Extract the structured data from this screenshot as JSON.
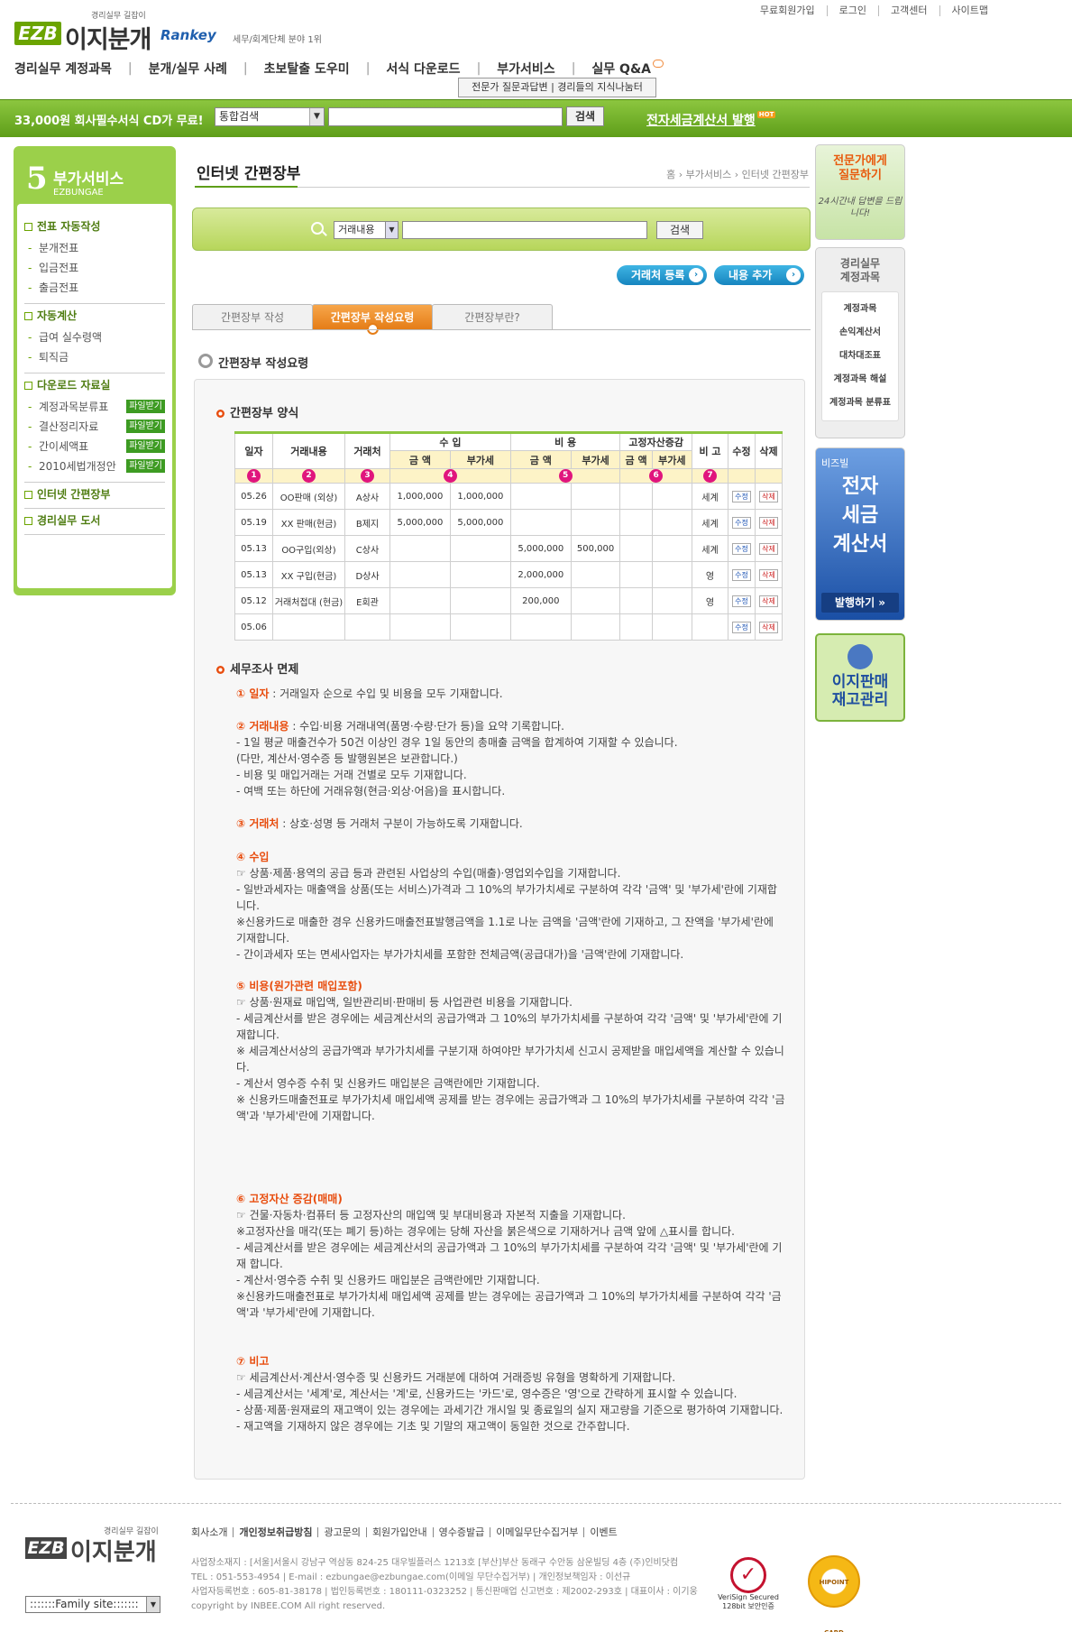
{
  "top_links": [
    "무료회원가입",
    "로그인",
    "고객센터",
    "사이트맵"
  ],
  "logo": {
    "tagline": "경리실무 길잡이",
    "mark": "EZB",
    "name": "이지분개",
    "partner": "Rankey",
    "partner_note": "세무/회계단체 분야 1위"
  },
  "gnb": [
    "경리실무 계정과목",
    "분개/실무 사례",
    "초보탈출 도우미",
    "서식 다운로드",
    "부가서비스",
    "실무 Q&A"
  ],
  "gnb_popup": "전문가 질문과답변 | 경리들의 지식나눔터",
  "greenbar": {
    "promo": "33,000원 회사필수서식 CD가 무료!",
    "select_value": "통합검색",
    "search_button": "검색",
    "etax_link": "전자세금계산서 발행",
    "hot": "HOT"
  },
  "lnb": {
    "number": "5",
    "title": "부가서비스",
    "title_en": "EZBUNGAE",
    "groups": [
      {
        "title": "전표 자동작성",
        "items": [
          {
            "label": "분개전표"
          },
          {
            "label": "입금전표"
          },
          {
            "label": "출금전표"
          }
        ]
      },
      {
        "title": "자동계산",
        "items": [
          {
            "label": "급여 실수령액"
          },
          {
            "label": "퇴직금"
          }
        ]
      },
      {
        "title": "다운로드 자료실",
        "items": [
          {
            "label": "계정과목분류표",
            "badge": "파일받기"
          },
          {
            "label": "결산정리자료",
            "badge": "파일받기"
          },
          {
            "label": "간이세액표",
            "badge": "파일받기"
          },
          {
            "label": "2010세법개정안",
            "badge": "파일받기"
          }
        ]
      },
      {
        "title": "인터넷 간편장부",
        "items": []
      },
      {
        "title": "경리실무 도서",
        "items": []
      }
    ]
  },
  "page": {
    "title": "인터넷 간편장부",
    "breadcrumb": "홈 › 부가서비스 › 인터넷 간편장부"
  },
  "search": {
    "select_value": "거래내용",
    "button": "검색"
  },
  "actions": {
    "register_partner": "거래처 등록",
    "add_content": "내용 추가"
  },
  "tabs": [
    "간편장부 작성",
    "간편장부 작성요령",
    "간편장부란?"
  ],
  "section_title": "간편장부 작성요령",
  "table": {
    "heading": "간편장부 양식",
    "groups": {
      "income": "수 입",
      "expense": "비 용",
      "asset": "고정자산증감"
    },
    "cols": {
      "date": "일자",
      "content": "거래내용",
      "partner": "거래처",
      "amount": "금 액",
      "vat": "부가세",
      "note": "비 고",
      "edit": "수정",
      "delete": "삭제"
    },
    "bubbles": [
      "1",
      "2",
      "3",
      "4",
      "5",
      "6",
      "7"
    ],
    "rows": [
      {
        "date": "05.26",
        "content": "OO판매 (외상)",
        "partner": "A상사",
        "inc_amt": "1,000,000",
        "inc_vat": "1,000,000",
        "exp_amt": "",
        "exp_vat": "",
        "as_amt": "",
        "as_vat": "",
        "note": "세계"
      },
      {
        "date": "05.19",
        "content": "XX 판매(현금)",
        "partner": "B제지",
        "inc_amt": "5,000,000",
        "inc_vat": "5,000,000",
        "exp_amt": "",
        "exp_vat": "",
        "as_amt": "",
        "as_vat": "",
        "note": "세계"
      },
      {
        "date": "05.13",
        "content": "OO구입(외상)",
        "partner": "C상사",
        "inc_amt": "",
        "inc_vat": "",
        "exp_amt": "5,000,000",
        "exp_vat": "500,000",
        "as_amt": "",
        "as_vat": "",
        "note": "세계"
      },
      {
        "date": "05.13",
        "content": "XX 구입(현금)",
        "partner": "D상사",
        "inc_amt": "",
        "inc_vat": "",
        "exp_amt": "2,000,000",
        "exp_vat": "",
        "as_amt": "",
        "as_vat": "",
        "note": "영"
      },
      {
        "date": "05.12",
        "content": "거래처접대 (현금)",
        "partner": "E회관",
        "inc_amt": "",
        "inc_vat": "",
        "exp_amt": "200,000",
        "exp_vat": "",
        "as_amt": "",
        "as_vat": "",
        "note": "영"
      },
      {
        "date": "05.06",
        "content": "",
        "partner": "",
        "inc_amt": "",
        "inc_vat": "",
        "exp_amt": "",
        "exp_vat": "",
        "as_amt": "",
        "as_vat": "",
        "note": ""
      }
    ],
    "edit_label": "수정",
    "delete_label": "삭제"
  },
  "guide": {
    "heading": "세무조사 면제",
    "items": [
      {
        "title": "① 일자",
        "lines": [
          ": 거래일자 순으로 수입 및 비용을 모두 기재합니다."
        ]
      },
      {
        "title": "② 거래내용",
        "lines": [
          ": 수입·비용 거래내역(품명·수량·단가 등)을 요약 기록합니다.",
          "- 1일 평균 매출건수가 50건 이상인 경우 1일 동안의 총매출 금액을 합계하여 기재할 수 있습니다.",
          "(다만, 계산서·영수증 등 발행원본은 보관합니다.)",
          "- 비용 및 매입거래는 거래 건별로 모두 기재합니다.",
          "- 여백 또는 하단에 거래유형(현금·외상·어음)을 표시합니다."
        ]
      },
      {
        "title": "③ 거래처",
        "lines": [
          ": 상호·성명 등 거래처 구분이 가능하도록 기재합니다."
        ]
      },
      {
        "title": "④ 수입",
        "lines": [
          "☞ 상품·제품·용역의 공급 등과 관련된 사업상의 수입(매출)·영업외수입을 기재합니다.",
          "- 일반과세자는 매출액을 상품(또는 서비스)가격과 그 10%의 부가가치세로 구분하여 각각 '금액' 및 '부가세'란에 기재합니다.",
          "※신용카드로 매출한 경우 신용카드매출전표발행금액을 1.1로 나눈 금액을 '금액'란에 기재하고, 그 잔액을 '부가세'란에 기재합니다.",
          "- 간이과세자 또는 면세사업자는 부가가치세를 포함한 전체금액(공급대가)을 '금액'란에 기재합니다."
        ]
      },
      {
        "title": "⑤ 비용(원가관련 매입포함)",
        "lines": [
          "☞ 상품·원재료 매입액, 일반관리비·판매비 등 사업관련 비용을 기재합니다.",
          "- 세금계산서를 받은 경우에는 세금계산서의 공급가액과 그 10%의 부가가치세를 구분하여 각각 '금액' 및 '부가세'란에 기재합니다.",
          "※ 세금계산서상의 공급가액과 부가가치세를 구분기재 하여야만 부가가치세 신고시 공제받을 매입세액을 계산할 수 있습니다.",
          "",
          "- 계산서 영수증 수취 및 신용카드 매입분은 금액란에만 기재합니다.",
          "",
          "※ 신용카드매출전표로 부가가치세 매입세액 공제를 받는 경우에는 공급가액과 그 10%의 부가가치세를 구분하여 각각 '금액'과 '부가세'란에 기재합니다."
        ]
      },
      {
        "title": "⑥ 고정자산 증감(매매)",
        "lines": [
          "☞ 건물·자동차·컴퓨터 등 고정자산의 매입액 및 부대비용과 자본적 지출을 기재합니다.",
          "※고정자산을 매각(또는 폐기 등)하는 경우에는 당해 자산을 붉은색으로 기재하거나 금액 앞에 △표시를 합니다.",
          "- 세금계산서를 받은 경우에는 세금계산서의 공급가액과 그 10%의 부가가치세를 구분하여 각각 '금액' 및 '부가세'란에 기재 합니다.",
          "- 계산서·영수증 수취 및 신용카드 매입분은 금액란에만 기재합니다.",
          "※신용카드매출전표로 부가가치세 매입세액 공제를 받는 경우에는 공급가액과 그 10%의 부가가치세를 구분하여 각각 '금액'과 '부가세'란에 기재합니다."
        ]
      },
      {
        "title": "⑦ 비고",
        "lines": [
          "☞ 세금계산서·계산서·영수증 및 신용카드 거래분에 대하여 거래증빙 유형을 명확하게 기재합니다.",
          "- 세금계산서는 '세계'로, 계산서는 '계'로, 신용카드는 '카드'로, 영수증은 '영'으로 간략하게 표시할 수 있습니다.",
          "- 상품·제품·원재료의 재고액이 있는 경우에는 과세기간 개시일 및 종료일의 실지 재고량을 기준으로 평가하여 기재합니다.",
          "- 재고액을 기재하지 않은 경우에는 기초 및 기말의 재고액이 동일한 것으로 간주합니다."
        ]
      }
    ]
  },
  "right": {
    "expert": {
      "line1": "전문가에게",
      "line2": "질문하기",
      "note": "24시간내 답변을 드립니다!"
    },
    "accounts": {
      "title1": "경리실무",
      "title2": "계정과목",
      "items": [
        "계정과목",
        "손익계산서",
        "대차대조표",
        "계정과목 해설",
        "계정과목 분류표"
      ]
    },
    "etax": {
      "brand": "비즈빌",
      "l1": "전자",
      "l2": "세금",
      "l3": "계산서",
      "button": "발행하기 »"
    },
    "inventory": {
      "l1": "이지판매",
      "l2": "재고관리"
    }
  },
  "footer": {
    "tagline": "경리실무 길잡이",
    "mark": "EZB",
    "name": "이지분개",
    "links": [
      "회사소개",
      "개인정보취급방침",
      "광고문의",
      "회원가입안내",
      "영수증발급",
      "이메일무단수집거부",
      "이벤트"
    ],
    "info": [
      "사업장소재지 : [서울]서울시 강남구 역삼동 824-25 대우빌플러스 1213호 [부산]부산 동래구 수안동 삼운빌딩 4층 (주)인비닷컴",
      "TEL : 051-553-4954 | E-mail : ezbungae@ezbungae.com(이메일 무단수집거부) | 개인정보책임자 : 이선규",
      "사업자등록번호 : 605-81-38178 | 법인등록번호 : 180111-0323252 | 통신판매업 신고번호 : 제2002-293호 | 대표이사 : 이기웅",
      "copyright by INBEE.COM All right reserved."
    ],
    "family_site": ":::::::Family site:::::::",
    "verisign": "128bit 보안인증",
    "verisign_name": "VeriSign Secured",
    "hipoint": "HIPOINT CARD"
  }
}
